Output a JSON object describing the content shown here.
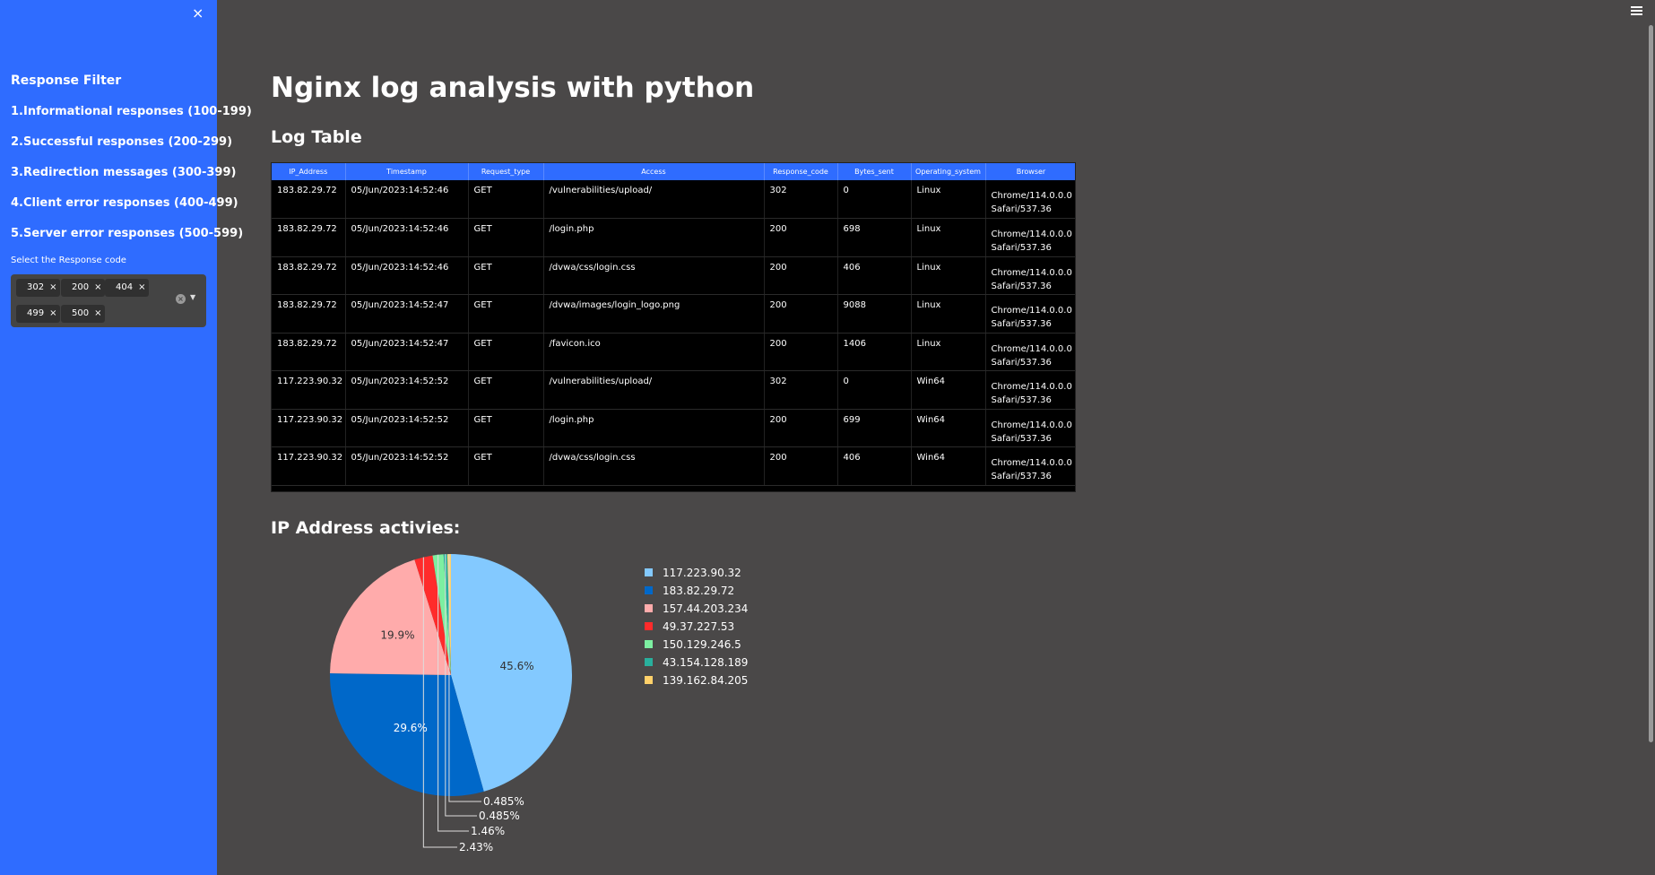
{
  "sidebar": {
    "close_icon": "×",
    "filter_title": "Response Filter",
    "ranges": [
      "1.Informational responses (100-199)",
      "2.Successful responses (200-299)",
      "3.Redirection messages (300-399)",
      "4.Client error responses (400-499)",
      "5.Server error responses (500-599)"
    ],
    "select_label": "Select the Response code",
    "chips": [
      "302",
      "200",
      "404",
      "499",
      "500"
    ],
    "chip_remove": "×",
    "clear_icon": "×",
    "dropdown_icon": "▼"
  },
  "main": {
    "title": "Nginx log analysis with python",
    "log_table_title": "Log Table",
    "ip_section_title": "IP Address activies:"
  },
  "table": {
    "headers": [
      "IP_Address",
      "Timestamp",
      "Request_type",
      "Access",
      "Response_code",
      "Bytes_sent",
      "Operating_system",
      "Browser"
    ],
    "rows": [
      [
        "183.82.29.72",
        "05/Jun/2023:14:52:46",
        "GET",
        "/vulnerabilities/upload/",
        "302",
        "0",
        "Linux",
        "Chrome/114.0.0.0 Safari/537.36"
      ],
      [
        "183.82.29.72",
        "05/Jun/2023:14:52:46",
        "GET",
        "/login.php",
        "200",
        "698",
        "Linux",
        "Chrome/114.0.0.0 Safari/537.36"
      ],
      [
        "183.82.29.72",
        "05/Jun/2023:14:52:46",
        "GET",
        "/dvwa/css/login.css",
        "200",
        "406",
        "Linux",
        "Chrome/114.0.0.0 Safari/537.36"
      ],
      [
        "183.82.29.72",
        "05/Jun/2023:14:52:47",
        "GET",
        "/dvwa/images/login_logo.png",
        "200",
        "9088",
        "Linux",
        "Chrome/114.0.0.0 Safari/537.36"
      ],
      [
        "183.82.29.72",
        "05/Jun/2023:14:52:47",
        "GET",
        "/favicon.ico",
        "200",
        "1406",
        "Linux",
        "Chrome/114.0.0.0 Safari/537.36"
      ],
      [
        "117.223.90.32",
        "05/Jun/2023:14:52:52",
        "GET",
        "/vulnerabilities/upload/",
        "302",
        "0",
        "Win64",
        "Chrome/114.0.0.0 Safari/537.36"
      ],
      [
        "117.223.90.32",
        "05/Jun/2023:14:52:52",
        "GET",
        "/login.php",
        "200",
        "699",
        "Win64",
        "Chrome/114.0.0.0 Safari/537.36"
      ],
      [
        "117.223.90.32",
        "05/Jun/2023:14:52:52",
        "GET",
        "/dvwa/css/login.css",
        "200",
        "406",
        "Win64",
        "Chrome/114.0.0.0 Safari/537.36"
      ]
    ]
  },
  "chart_data": {
    "type": "pie",
    "categories": [
      "117.223.90.32",
      "183.82.29.72",
      "157.44.203.234",
      "49.37.227.53",
      "150.129.246.5",
      "43.154.128.189",
      "139.162.84.205"
    ],
    "values": [
      45.6,
      29.6,
      19.9,
      2.43,
      1.46,
      0.485,
      0.485
    ],
    "labels": [
      "45.6%",
      "29.6%",
      "19.9%",
      "2.43%",
      "1.46%",
      "0.485%",
      "0.485%"
    ],
    "colors": [
      "#83c9ff",
      "#0068c9",
      "#ffabab",
      "#ff2b2b",
      "#7defa1",
      "#29b09d",
      "#ffd16a"
    ],
    "legend": "right"
  },
  "colors": {
    "sidebar": "#2f6cff",
    "background": "#4a4848",
    "table_header": "#2f6cff"
  }
}
